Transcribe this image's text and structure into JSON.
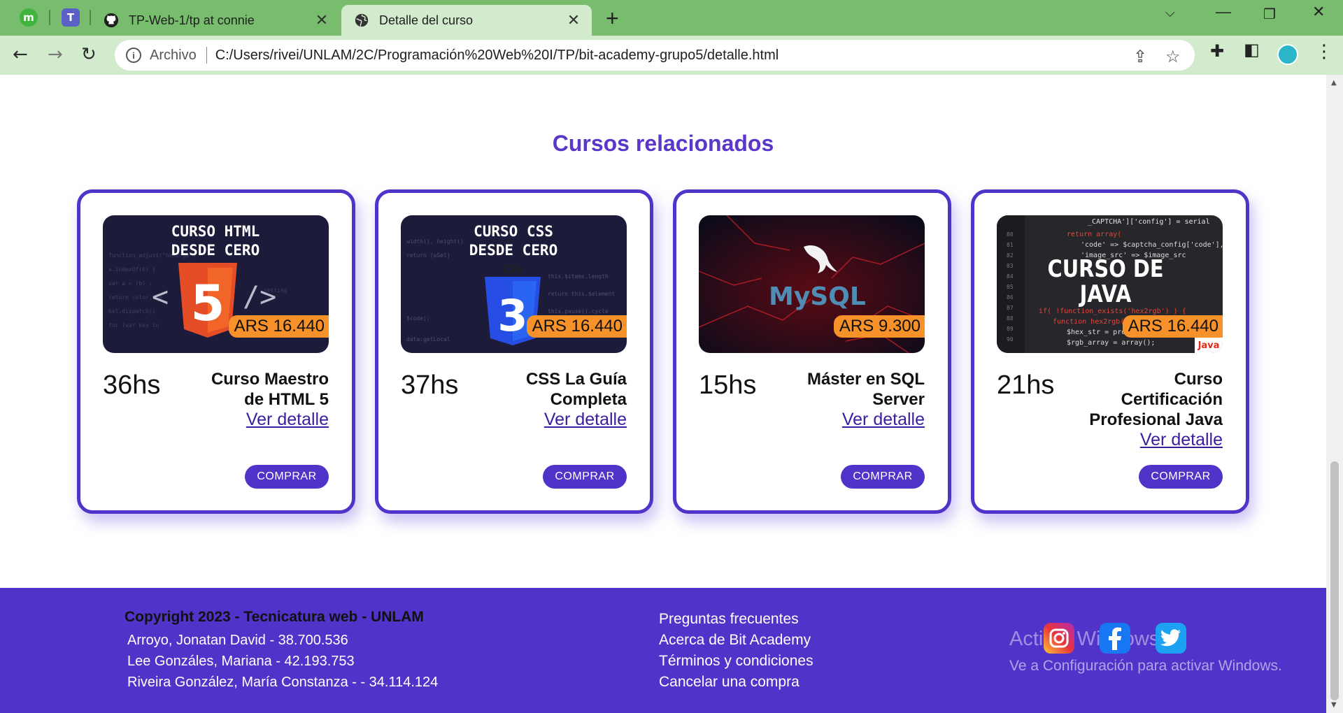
{
  "browser": {
    "tabs": [
      {
        "title": "TP-Web-1/tp at connie",
        "active": false,
        "favicon": "github-icon"
      },
      {
        "title": "Detalle del curso",
        "active": true,
        "favicon": "globe-icon"
      }
    ],
    "pinned_tabs": [
      "m",
      "T"
    ],
    "address": {
      "scheme_label": "Archivo",
      "url": "C:/Users/rivei/UNLAM/2C/Programaci%C3%B3n%20Web%20I/TP/bit-academy-grupo5/detalle.html"
    },
    "url_display": "C:/Users/rivei/UNLAM/2C/Programación%20Web%20I/TP/bit-academy-grupo5/detalle.html",
    "colors": {
      "tabbar": "#78bc6e",
      "toolbar": "#d1ebcc"
    }
  },
  "page": {
    "section_title": "Cursos relacionados",
    "detail_link_label": "Ver detalle",
    "buy_label": "COMPRAR",
    "accent": "#5033c8",
    "price_badge_color": "#f7922a",
    "courses": [
      {
        "title": "Curso Maestro de HTML 5",
        "hours": "36hs",
        "price": "ARS 16.440",
        "image_text": [
          "CURSO HTML",
          "DESDE CERO"
        ],
        "image_icon": "html5-logo-icon"
      },
      {
        "title": "CSS La Guía Completa",
        "hours": "37hs",
        "price": "ARS 16.440",
        "image_text": [
          "CURSO CSS",
          "DESDE CERO"
        ],
        "image_icon": "css3-logo-icon"
      },
      {
        "title": "Máster en SQL Server",
        "hours": "15hs",
        "price": "ARS 9.300",
        "image_text": [
          "MySQL"
        ],
        "image_icon": "mysql-dolphin-icon"
      },
      {
        "title": "Curso Certificación Profesional Java",
        "hours": "21hs",
        "price": "ARS 16.440",
        "image_text": [
          "CURSO DE",
          "JAVA"
        ],
        "image_icon": "java-logo-icon"
      }
    ]
  },
  "footer": {
    "copyright": "Copyright 2023 - Tecnicatura web - UNLAM",
    "members": [
      "Arroyo, Jonatan David - 38.700.536",
      "Lee Gonzáles, Mariana - 42.193.753",
      "Riveira González, María Constanza - - 34.114.124"
    ],
    "links": [
      "Preguntas frecuentes",
      "Acerca de Bit Academy",
      "Términos y condiciones",
      "Cancelar una compra"
    ],
    "social": [
      "instagram-icon",
      "facebook-icon",
      "twitter-icon"
    ]
  },
  "os_watermark": {
    "line1": "Activar Windows",
    "line2": "Ve a Configuración para activar Windows."
  }
}
